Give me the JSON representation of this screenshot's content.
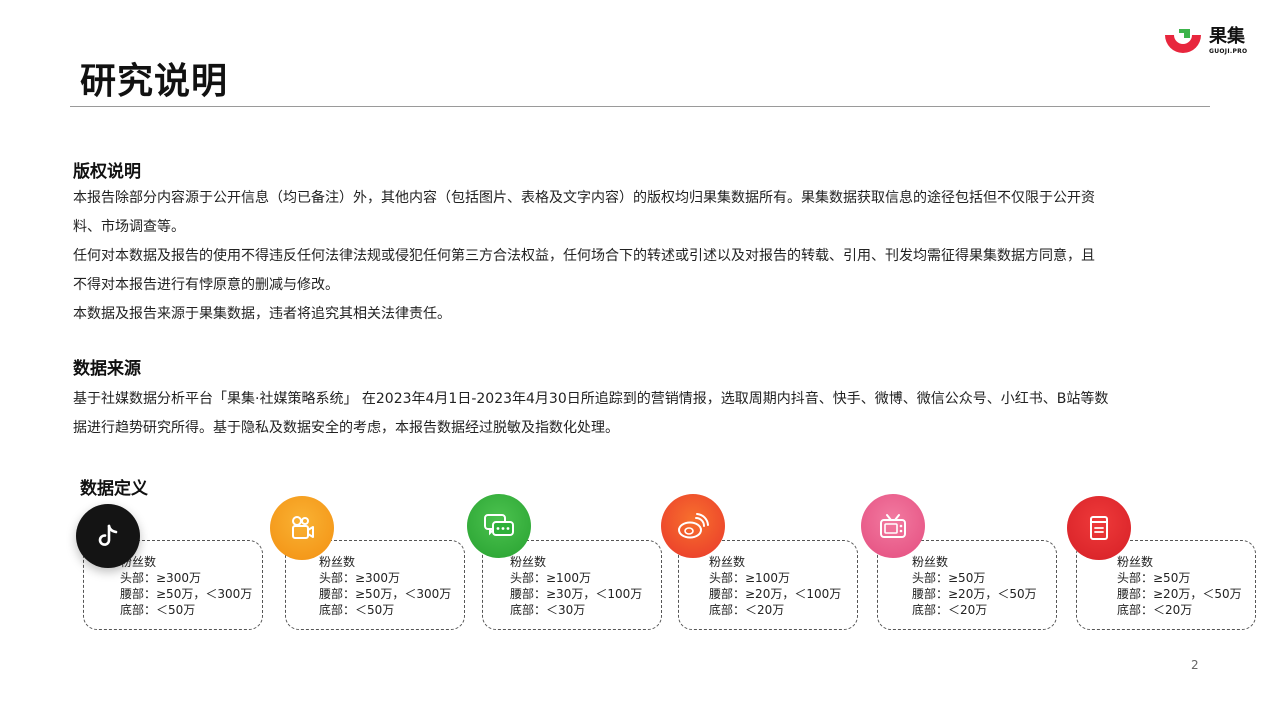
{
  "header": {
    "title": "研究说明",
    "logo_text": "果集",
    "logo_sub": "GUOJI.PRO"
  },
  "copyright": {
    "heading": "版权说明",
    "lines": [
      "本报告除部分内容源于公开信息（均已备注）外，其他内容（包括图片、表格及文字内容）的版权均归果集数据所有。果集数据获取信息的途径包括但不仅限于公开资",
      "料、市场调查等。",
      "任何对本数据及报告的使用不得违反任何法律法规或侵犯任何第三方合法权益，任何场合下的转述或引述以及对报告的转载、引用、刊发均需征得果集数据方同意，且",
      "不得对本报告进行有悖原意的删减与修改。",
      "本数据及报告来源于果集数据，违者将追究其相关法律责任。"
    ]
  },
  "source": {
    "heading": "数据来源",
    "lines": [
      "基于社媒数据分析平台「果集·社媒策略系统」 在2023年4月1日-2023年4月30日所追踪到的营销情报，选取周期内抖音、快手、微博、微信公众号、小红书、B站等数",
      "据进行趋势研究所得。基于隐私及数据安全的考虑，本报告数据经过脱敏及指数化处理。"
    ]
  },
  "definition": {
    "heading": "数据定义",
    "cards": [
      {
        "icon": "douyin-icon",
        "color": "#1a1a1a",
        "lines": [
          "粉丝数",
          "头部：≥300万",
          "腰部：≥50万，＜300万",
          "底部：＜50万"
        ]
      },
      {
        "icon": "kuaishou-icon",
        "color": "#f7a21b",
        "lines": [
          "粉丝数",
          "头部：≥300万",
          "腰部：≥50万，＜300万",
          "底部：＜50万"
        ]
      },
      {
        "icon": "wechat-icon",
        "color": "#2fb03a",
        "lines": [
          "粉丝数",
          "头部：≥100万",
          "腰部：≥30万，＜100万",
          "底部：＜30万"
        ]
      },
      {
        "icon": "weibo-icon",
        "color": "#ef4b2d",
        "lines": [
          "粉丝数",
          "头部：≥100万",
          "腰部：≥20万，＜100万",
          "底部：＜20万"
        ]
      },
      {
        "icon": "bilibili-icon",
        "color": "#ec5d8c",
        "lines": [
          "粉丝数",
          "头部：≥50万",
          "腰部：≥20万，＜50万",
          "底部：＜20万"
        ]
      },
      {
        "icon": "xiaohongshu-icon",
        "color": "#e5262b",
        "lines": [
          "粉丝数",
          "头部：≥50万",
          "腰部：≥20万，＜50万",
          "底部：＜20万"
        ]
      }
    ]
  },
  "page_number": "2"
}
